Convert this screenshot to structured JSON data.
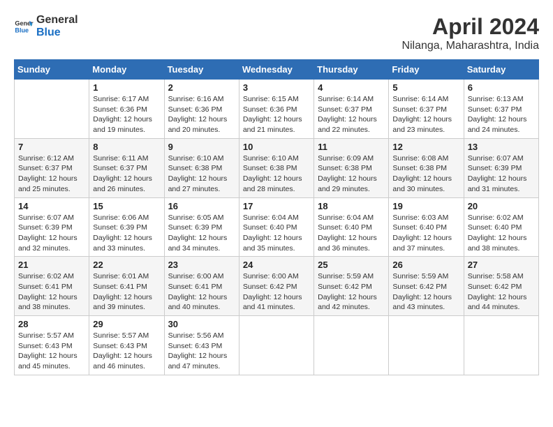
{
  "header": {
    "logo_line1": "General",
    "logo_line2": "Blue",
    "title": "April 2024",
    "subtitle": "Nilanga, Maharashtra, India"
  },
  "columns": [
    "Sunday",
    "Monday",
    "Tuesday",
    "Wednesday",
    "Thursday",
    "Friday",
    "Saturday"
  ],
  "weeks": [
    [
      {
        "day": "",
        "info": ""
      },
      {
        "day": "1",
        "info": "Sunrise: 6:17 AM\nSunset: 6:36 PM\nDaylight: 12 hours\nand 19 minutes."
      },
      {
        "day": "2",
        "info": "Sunrise: 6:16 AM\nSunset: 6:36 PM\nDaylight: 12 hours\nand 20 minutes."
      },
      {
        "day": "3",
        "info": "Sunrise: 6:15 AM\nSunset: 6:36 PM\nDaylight: 12 hours\nand 21 minutes."
      },
      {
        "day": "4",
        "info": "Sunrise: 6:14 AM\nSunset: 6:37 PM\nDaylight: 12 hours\nand 22 minutes."
      },
      {
        "day": "5",
        "info": "Sunrise: 6:14 AM\nSunset: 6:37 PM\nDaylight: 12 hours\nand 23 minutes."
      },
      {
        "day": "6",
        "info": "Sunrise: 6:13 AM\nSunset: 6:37 PM\nDaylight: 12 hours\nand 24 minutes."
      }
    ],
    [
      {
        "day": "7",
        "info": "Sunrise: 6:12 AM\nSunset: 6:37 PM\nDaylight: 12 hours\nand 25 minutes."
      },
      {
        "day": "8",
        "info": "Sunrise: 6:11 AM\nSunset: 6:37 PM\nDaylight: 12 hours\nand 26 minutes."
      },
      {
        "day": "9",
        "info": "Sunrise: 6:10 AM\nSunset: 6:38 PM\nDaylight: 12 hours\nand 27 minutes."
      },
      {
        "day": "10",
        "info": "Sunrise: 6:10 AM\nSunset: 6:38 PM\nDaylight: 12 hours\nand 28 minutes."
      },
      {
        "day": "11",
        "info": "Sunrise: 6:09 AM\nSunset: 6:38 PM\nDaylight: 12 hours\nand 29 minutes."
      },
      {
        "day": "12",
        "info": "Sunrise: 6:08 AM\nSunset: 6:38 PM\nDaylight: 12 hours\nand 30 minutes."
      },
      {
        "day": "13",
        "info": "Sunrise: 6:07 AM\nSunset: 6:39 PM\nDaylight: 12 hours\nand 31 minutes."
      }
    ],
    [
      {
        "day": "14",
        "info": "Sunrise: 6:07 AM\nSunset: 6:39 PM\nDaylight: 12 hours\nand 32 minutes."
      },
      {
        "day": "15",
        "info": "Sunrise: 6:06 AM\nSunset: 6:39 PM\nDaylight: 12 hours\nand 33 minutes."
      },
      {
        "day": "16",
        "info": "Sunrise: 6:05 AM\nSunset: 6:39 PM\nDaylight: 12 hours\nand 34 minutes."
      },
      {
        "day": "17",
        "info": "Sunrise: 6:04 AM\nSunset: 6:40 PM\nDaylight: 12 hours\nand 35 minutes."
      },
      {
        "day": "18",
        "info": "Sunrise: 6:04 AM\nSunset: 6:40 PM\nDaylight: 12 hours\nand 36 minutes."
      },
      {
        "day": "19",
        "info": "Sunrise: 6:03 AM\nSunset: 6:40 PM\nDaylight: 12 hours\nand 37 minutes."
      },
      {
        "day": "20",
        "info": "Sunrise: 6:02 AM\nSunset: 6:40 PM\nDaylight: 12 hours\nand 38 minutes."
      }
    ],
    [
      {
        "day": "21",
        "info": "Sunrise: 6:02 AM\nSunset: 6:41 PM\nDaylight: 12 hours\nand 38 minutes."
      },
      {
        "day": "22",
        "info": "Sunrise: 6:01 AM\nSunset: 6:41 PM\nDaylight: 12 hours\nand 39 minutes."
      },
      {
        "day": "23",
        "info": "Sunrise: 6:00 AM\nSunset: 6:41 PM\nDaylight: 12 hours\nand 40 minutes."
      },
      {
        "day": "24",
        "info": "Sunrise: 6:00 AM\nSunset: 6:42 PM\nDaylight: 12 hours\nand 41 minutes."
      },
      {
        "day": "25",
        "info": "Sunrise: 5:59 AM\nSunset: 6:42 PM\nDaylight: 12 hours\nand 42 minutes."
      },
      {
        "day": "26",
        "info": "Sunrise: 5:59 AM\nSunset: 6:42 PM\nDaylight: 12 hours\nand 43 minutes."
      },
      {
        "day": "27",
        "info": "Sunrise: 5:58 AM\nSunset: 6:42 PM\nDaylight: 12 hours\nand 44 minutes."
      }
    ],
    [
      {
        "day": "28",
        "info": "Sunrise: 5:57 AM\nSunset: 6:43 PM\nDaylight: 12 hours\nand 45 minutes."
      },
      {
        "day": "29",
        "info": "Sunrise: 5:57 AM\nSunset: 6:43 PM\nDaylight: 12 hours\nand 46 minutes."
      },
      {
        "day": "30",
        "info": "Sunrise: 5:56 AM\nSunset: 6:43 PM\nDaylight: 12 hours\nand 47 minutes."
      },
      {
        "day": "",
        "info": ""
      },
      {
        "day": "",
        "info": ""
      },
      {
        "day": "",
        "info": ""
      },
      {
        "day": "",
        "info": ""
      }
    ]
  ]
}
